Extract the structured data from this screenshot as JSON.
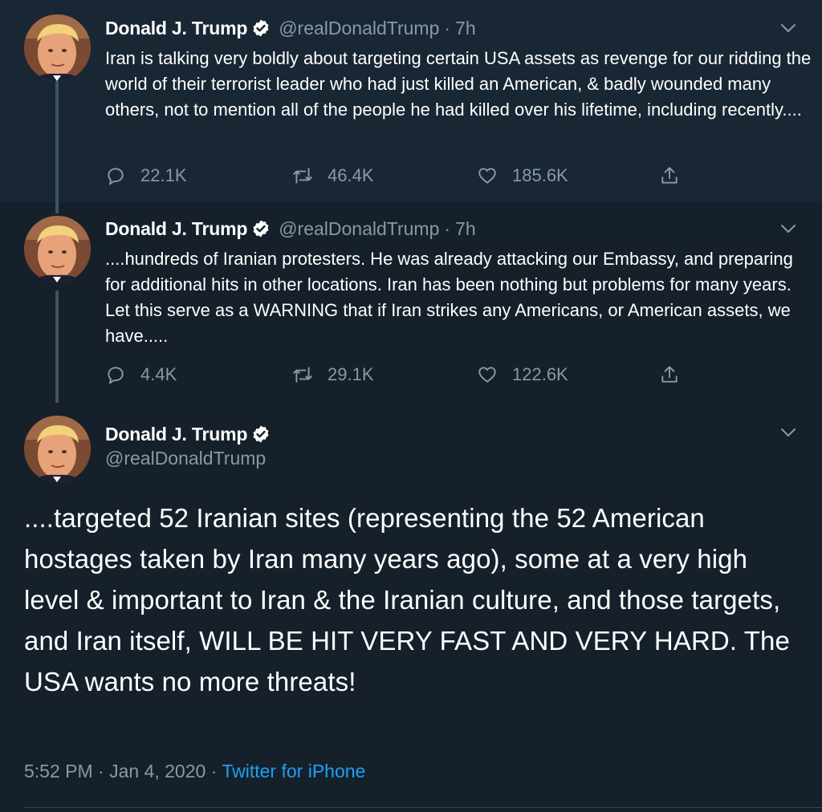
{
  "tweets": [
    {
      "name": "Donald J. Trump",
      "handle": "@realDonaldTrump",
      "separator": "·",
      "time": "7h",
      "text": "Iran is talking very boldly about targeting certain USA assets as revenge for our ridding the world of their terrorist leader who had just killed an American, & badly wounded many others, not to mention all of the people he had killed over his lifetime, including recently....",
      "replies": "22.1K",
      "retweets": "46.4K",
      "likes": "185.6K"
    },
    {
      "name": "Donald J. Trump",
      "handle": "@realDonaldTrump",
      "separator": "·",
      "time": "7h",
      "text": "....hundreds of Iranian protesters. He was already attacking our Embassy, and preparing for additional hits in other locations. Iran has been nothing but problems for many years. Let this serve as a WARNING that if Iran strikes any Americans, or American assets, we have.....",
      "replies": "4.4K",
      "retweets": "29.1K",
      "likes": "122.6K"
    }
  ],
  "focused": {
    "name": "Donald J. Trump",
    "handle": "@realDonaldTrump",
    "text": "....targeted 52 Iranian sites (representing the 52 American hostages taken by Iran many years ago), some at a very high level & important to Iran & the Iranian culture, and those targets, and Iran itself, WILL BE HIT VERY FAST AND VERY HARD. The USA wants no more threats!",
    "timestamp": "5:52 PM · Jan 4, 2020",
    "separator": "·",
    "source": "Twitter for iPhone"
  },
  "icons": {
    "verified": "verified-badge-icon",
    "menu": "chevron-down-icon",
    "reply": "reply-icon",
    "retweet": "retweet-icon",
    "like": "heart-icon",
    "share": "share-icon"
  },
  "colors": {
    "background": "#15202b",
    "highlight_background": "#192734",
    "secondary_text": "#8899a6",
    "link": "#1da1f2",
    "thread_line": "#3d5466"
  }
}
